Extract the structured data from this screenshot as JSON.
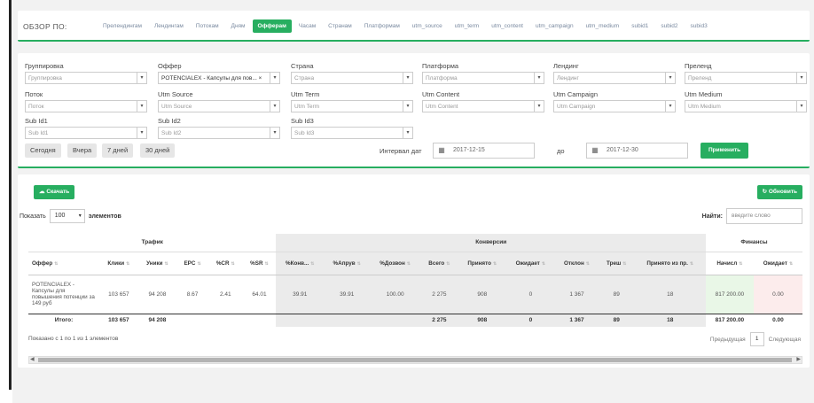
{
  "overview": {
    "label": "ОБЗОР ПО:",
    "tabs": [
      "Прелендингам",
      "Лендингам",
      "Потокам",
      "Дням",
      "Офферам",
      "Часам",
      "Странам",
      "Платформам",
      "utm_source",
      "utm_term",
      "utm_content",
      "utm_campaign",
      "utm_medium",
      "subid1",
      "subid2",
      "subid3"
    ],
    "active_tab": "Офферам"
  },
  "filters": {
    "grouping": {
      "label": "Группировка",
      "value": "Группировка"
    },
    "offer": {
      "label": "Оффер",
      "value": "POTENCIALEX - Капсулы для пов... ×"
    },
    "country": {
      "label": "Страна",
      "value": "Страна"
    },
    "platform": {
      "label": "Платформа",
      "value": "Платформа"
    },
    "landing": {
      "label": "Лендинг",
      "value": "Лендинг"
    },
    "prelanding": {
      "label": "Преленд",
      "value": "Преленд"
    },
    "stream": {
      "label": "Поток",
      "value": "Поток"
    },
    "utm_source": {
      "label": "Utm Source",
      "value": "Utm Source"
    },
    "utm_term": {
      "label": "Utm Term",
      "value": "Utm Term"
    },
    "utm_content": {
      "label": "Utm Content",
      "value": "Utm Content"
    },
    "utm_campaign": {
      "label": "Utm Campaign",
      "value": "Utm Campaign"
    },
    "utm_medium": {
      "label": "Utm Medium",
      "value": "Utm Medium"
    },
    "subid1": {
      "label": "Sub Id1",
      "value": "Sub Id1"
    },
    "subid2": {
      "label": "Sub Id2",
      "value": "Sub Id2"
    },
    "subid3": {
      "label": "Sub Id3",
      "value": "Sub Id3"
    },
    "quick": {
      "today": "Сегодня",
      "yesterday": "Вчера",
      "week": "7 дней",
      "month": "30 дней"
    },
    "date_label": "Интервал дат",
    "date_from": "2017-12-15",
    "to_label": "до",
    "date_to": "2017-12-30",
    "apply": "Применить"
  },
  "table": {
    "download": "Скачать",
    "refresh": "Обновить",
    "show_prefix": "Показать",
    "show_value": "100",
    "show_suffix": "элементов",
    "search_label": "Найти:",
    "search_placeholder": "введите слово",
    "groups": {
      "traffic": "Трафик",
      "conversions": "Конверсии",
      "finance": "Финансы"
    },
    "columns": [
      "Оффер",
      "Клики",
      "Уники",
      "EPC",
      "%CR",
      "%SR",
      "%Конв...",
      "%Апрув",
      "%Дозвон",
      "Всего",
      "Принято",
      "Ожидает",
      "Отклон",
      "Треш",
      "Принято из пр.",
      "Начисл",
      "Ожидает"
    ],
    "row": [
      "POTENCIALEX - Капсулы для повышения потенции за 149 руб",
      "103 657",
      "94 208",
      "8.67",
      "2.41",
      "64.01",
      "39.91",
      "39.91",
      "100.00",
      "2 275",
      "908",
      "0",
      "1 367",
      "89",
      "18",
      "817 200.00",
      "0.00"
    ],
    "total": [
      "Итого:",
      "103 657",
      "94 208",
      "",
      "",
      "",
      "",
      "",
      "",
      "2 275",
      "908",
      "0",
      "1 367",
      "89",
      "18",
      "817 200.00",
      "0.00"
    ],
    "info": "Показано с 1 по 1 из 1 элементов",
    "prev": "Предыдущая",
    "page": "1",
    "next": "Следующая"
  }
}
